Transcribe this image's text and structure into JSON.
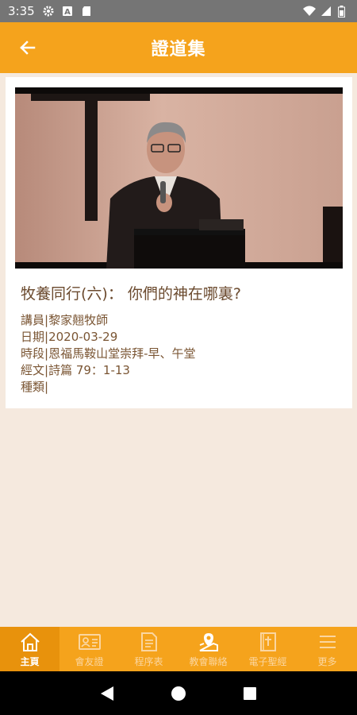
{
  "status_bar": {
    "time": "3:35"
  },
  "app_bar": {
    "title": "證道集"
  },
  "sermon": {
    "title": "牧養同行(六)： 你們的神在哪裏?",
    "speaker_label": "講員|",
    "speaker": "黎家翹牧師",
    "date_label": "日期|",
    "date": "2020-03-29",
    "session_label": "時段|",
    "session": "恩福馬鞍山堂崇拜-早、午堂",
    "scripture_label": "經文|",
    "scripture": "詩篇 79：1-13",
    "category_label": "種類|",
    "category": ""
  },
  "bottom_nav": {
    "items": [
      {
        "label": "主頁",
        "icon": "home-icon",
        "active": true
      },
      {
        "label": "會友證",
        "icon": "member-card-icon",
        "active": false
      },
      {
        "label": "程序表",
        "icon": "program-sheet-icon",
        "active": false
      },
      {
        "label": "教會聯絡",
        "icon": "church-contact-icon",
        "active": false
      },
      {
        "label": "電子聖經",
        "icon": "bible-icon",
        "active": false
      },
      {
        "label": "更多",
        "icon": "menu-icon",
        "active": false
      }
    ]
  },
  "colors": {
    "app_bar": "#f5a31c",
    "nav_active": "#e8920c",
    "background": "#f5e9de",
    "title_text": "#6b4a2e"
  }
}
